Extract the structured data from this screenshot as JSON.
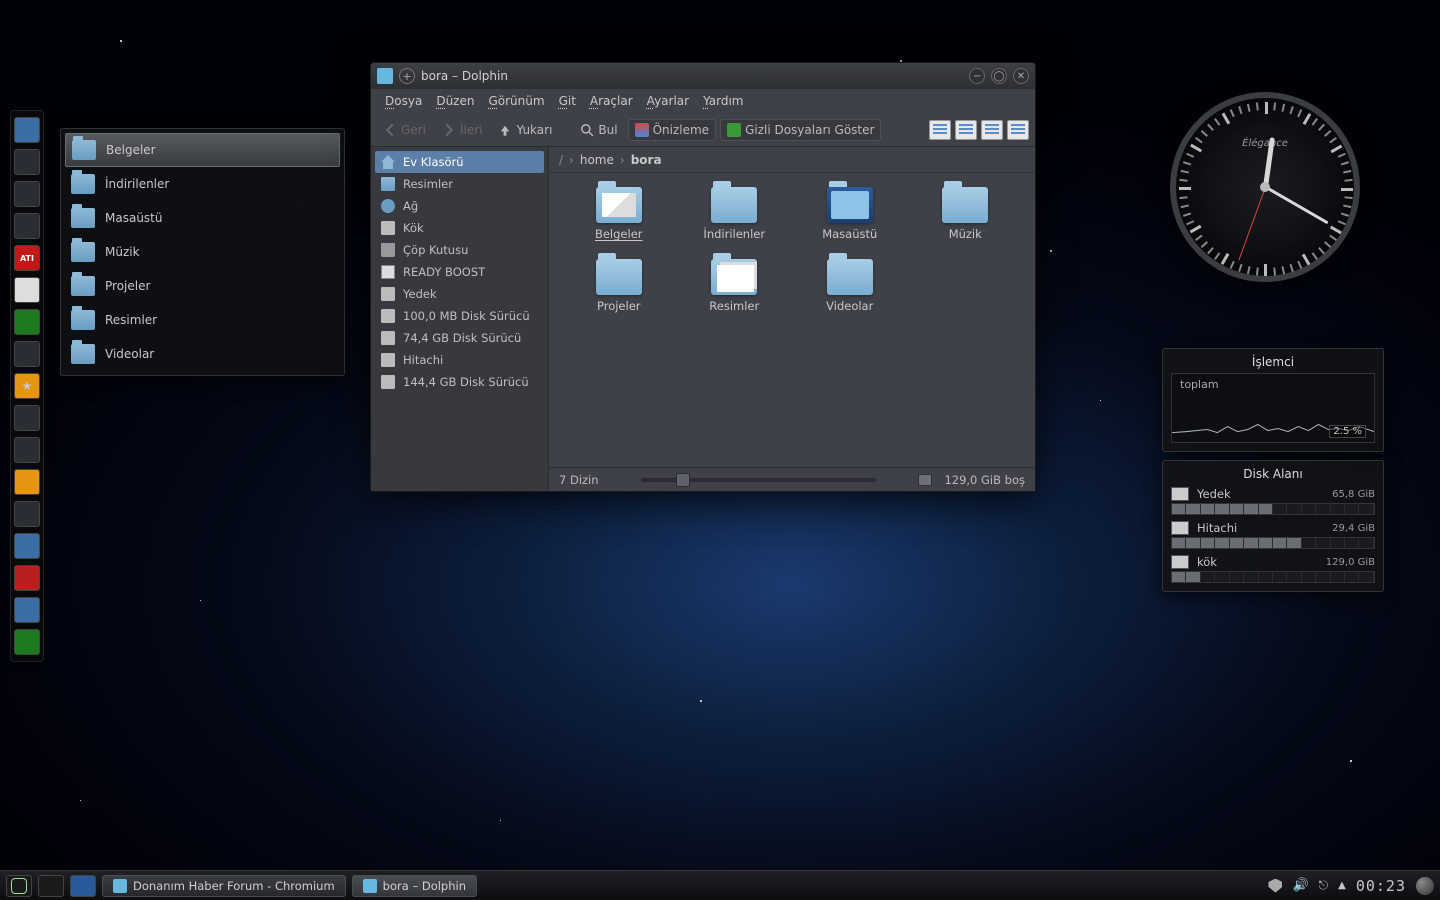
{
  "quickview": {
    "items": [
      {
        "label": "Belgeler",
        "selected": true
      },
      {
        "label": "İndirilenler"
      },
      {
        "label": "Masaüstü"
      },
      {
        "label": "Müzik"
      },
      {
        "label": "Projeler"
      },
      {
        "label": "Resimler"
      },
      {
        "label": "Videolar"
      }
    ]
  },
  "window": {
    "title": "bora – Dolphin",
    "menu": [
      "Dosya",
      "Düzen",
      "Görünüm",
      "Git",
      "Araçlar",
      "Ayarlar",
      "Yardım"
    ],
    "toolbar": {
      "back": "Geri",
      "forward": "İleri",
      "up": "Yukarı",
      "find": "Bul",
      "preview": "Önizleme",
      "hidden": "Gizli Dosyaları Göster"
    },
    "breadcrumb": {
      "root": "/",
      "parts": [
        "home",
        "bora"
      ]
    },
    "places": [
      {
        "label": "Ev Klasörü",
        "type": "home",
        "selected": true
      },
      {
        "label": "Resimler",
        "type": "folder"
      },
      {
        "label": "Ağ",
        "type": "net"
      },
      {
        "label": "Kök",
        "type": "disk"
      },
      {
        "label": "Çöp Kutusu",
        "type": "trash"
      },
      {
        "label": "READY BOOST",
        "type": "usb"
      },
      {
        "label": "Yedek",
        "type": "disk"
      },
      {
        "label": "100,0 MB Disk Sürücü",
        "type": "disk"
      },
      {
        "label": "74,4 GB Disk Sürücü",
        "type": "disk"
      },
      {
        "label": "Hitachi",
        "type": "disk"
      },
      {
        "label": "144,4 GB Disk Sürücü",
        "type": "disk"
      }
    ],
    "files": [
      {
        "label": "Belgeler",
        "kind": "doc",
        "selected": true
      },
      {
        "label": "İndirilenler",
        "kind": "plain"
      },
      {
        "label": "Masaüstü",
        "kind": "desk"
      },
      {
        "label": "Müzik",
        "kind": "plain"
      },
      {
        "label": "Projeler",
        "kind": "plain"
      },
      {
        "label": "Resimler",
        "kind": "pic"
      },
      {
        "label": "Videolar",
        "kind": "plain"
      }
    ],
    "status": {
      "count": "7 Dizin",
      "free": "129,0 GiB boş"
    }
  },
  "clock": {
    "brand": "Élégance"
  },
  "cpu": {
    "title": "İşlemci",
    "label": "toplam",
    "pct": "2.5 %"
  },
  "disk": {
    "title": "Disk Alanı",
    "volumes": [
      {
        "name": "Yedek",
        "size": "65,8 GiB",
        "fill": 7
      },
      {
        "name": "Hitachi",
        "size": "29,4 GiB",
        "fill": 9
      },
      {
        "name": "kök",
        "size": "129,0 GiB",
        "fill": 2
      }
    ]
  },
  "taskbar": {
    "tasks": [
      {
        "label": "Donanım Haber Forum - Chromium",
        "active": false
      },
      {
        "label": "bora – Dolphin",
        "active": true
      }
    ],
    "time": "00:23"
  },
  "launcher_items": [
    "home",
    "folder",
    "monitor",
    "monitor",
    "ati",
    "disc",
    "green",
    "tool",
    "star",
    "term",
    "cd",
    "vlc",
    "clap",
    "globe",
    "pdf",
    "writer",
    "calc"
  ]
}
